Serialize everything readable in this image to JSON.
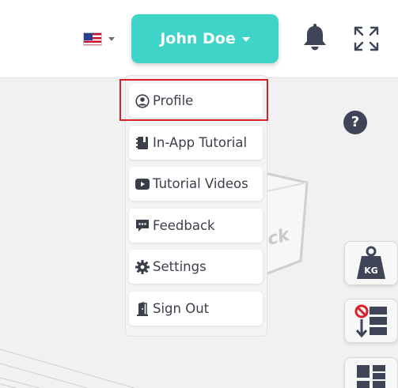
{
  "header": {
    "user_name": "John Doe",
    "language_icon": "us-flag-icon"
  },
  "menu": {
    "items": [
      {
        "label": "Profile",
        "icon": "user-circle-icon"
      },
      {
        "label": "In-App Tutorial",
        "icon": "book-icon"
      },
      {
        "label": "Tutorial Videos",
        "icon": "youtube-icon"
      },
      {
        "label": "Feedback",
        "icon": "comment-icon"
      },
      {
        "label": "Settings",
        "icon": "gear-icon"
      },
      {
        "label": "Sign Out",
        "icon": "door-icon"
      }
    ],
    "highlighted_item": "Profile"
  },
  "canvas": {
    "box_text": "Block",
    "help_label": "?",
    "weight_label": "KG"
  },
  "colors": {
    "accent": "#3ed5c8",
    "highlight": "#d81f2a",
    "dark": "#3f4456"
  }
}
